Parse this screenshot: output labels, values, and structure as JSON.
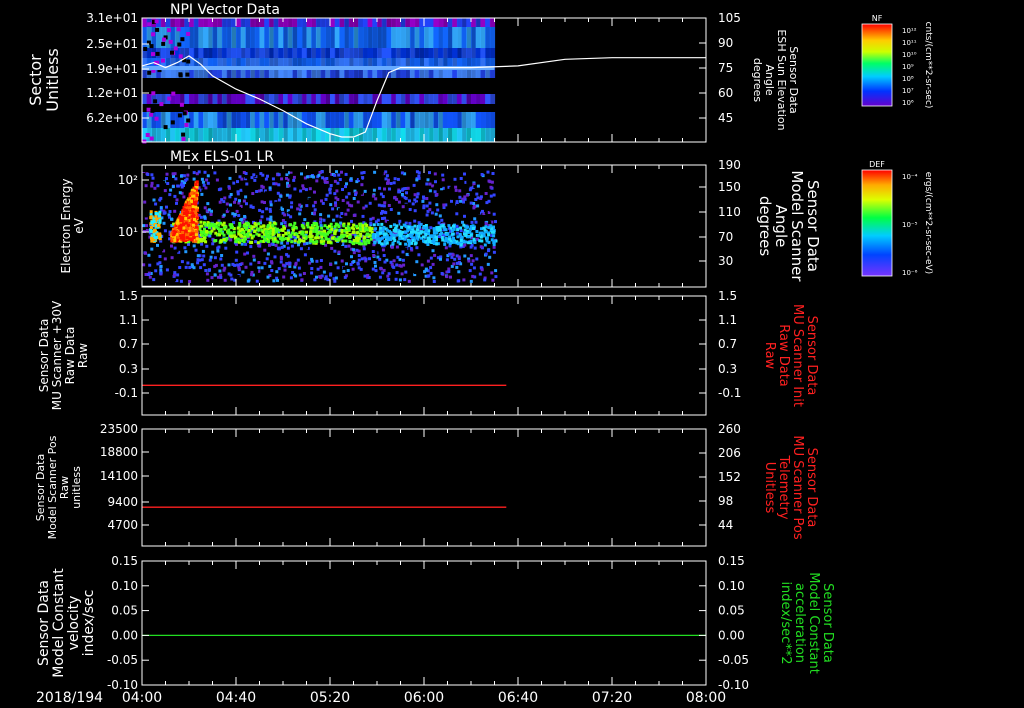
{
  "time_axis": {
    "date": "2018/194",
    "ticks": [
      "04:00",
      "04:40",
      "05:20",
      "06:00",
      "06:40",
      "07:20",
      "08:00"
    ],
    "range_minutes": [
      0,
      240
    ]
  },
  "colors": {
    "background": "#000000",
    "frame": "#ffffff",
    "red_series": "#ff2020",
    "green_series": "#22dd22"
  },
  "chart_data": [
    {
      "type": "heatmap",
      "title": "NPI Vector Data",
      "ylabel": [
        "Sector",
        "Unitless"
      ],
      "y_ticks": [
        "3.1e+01",
        "2.5e+01",
        "1.9e+01",
        "1.2e+01",
        "6.2e+00"
      ],
      "y2label": [
        "Sensor Data",
        "ESH Sun Elevation",
        "Angle",
        "degrees"
      ],
      "y2_ticks": [
        "105",
        "90",
        "75",
        "60",
        "45"
      ],
      "y2lim": [
        30,
        105
      ],
      "data_extent_minutes": [
        0,
        150
      ],
      "overlay_line": {
        "color": "#ffffff",
        "x": [
          0,
          5,
          10,
          15,
          20,
          25,
          30,
          40,
          50,
          60,
          70,
          80,
          85,
          90,
          95,
          100,
          105,
          110,
          120,
          140,
          160,
          180,
          200,
          220,
          240
        ],
        "y": [
          76,
          78,
          75,
          78,
          82,
          77,
          70,
          62,
          56,
          49,
          41,
          35,
          33,
          33,
          36,
          55,
          72,
          75,
          75,
          75,
          76,
          80,
          81,
          81,
          81
        ]
      },
      "colorbar": {
        "label": "NF",
        "unit": "cnts/(cm**2-sr-sec)",
        "ticks": [
          "10¹²",
          "10¹¹",
          "10¹⁰",
          "10⁹",
          "10⁸",
          "10⁷",
          "10⁶"
        ]
      }
    },
    {
      "type": "heatmap",
      "title": "MEx ELS-01 LR",
      "ylabel": [
        "Electron Energy",
        "eV"
      ],
      "y_ticks": [
        "10²",
        "10¹"
      ],
      "y2label": [
        "Sensor Data",
        "Model Scanner",
        "Angle",
        "degrees"
      ],
      "y2_ticks": [
        "190",
        "150",
        "110",
        "70",
        "30"
      ],
      "y2lim": [
        10,
        190
      ],
      "data_extent_minutes": [
        0,
        150
      ],
      "overlay_line": {
        "color": "#ffffff",
        "x": [
          0,
          150
        ],
        "y": [
          11,
          11
        ]
      },
      "colorbar": {
        "label": "DEF",
        "unit": "ergs/(cm**2-sr-sec-eV)",
        "ticks": [
          "10⁻⁴",
          "10⁻⁵",
          "10⁻⁶"
        ]
      }
    },
    {
      "type": "line",
      "ylabel": [
        "Sensor Data",
        "MU Scanner +30V",
        "Raw Data",
        "Raw"
      ],
      "y_ticks": [
        "1.5",
        "1.1",
        "0.7",
        "0.3",
        "-0.1"
      ],
      "ylim": [
        -0.5,
        1.5
      ],
      "y2label": [
        "Sensor Data",
        "MU Scanner Init",
        "Raw Data",
        "Raw"
      ],
      "y2_ticks": [
        "1.5",
        "1.1",
        "0.7",
        "0.3",
        "-0.1"
      ],
      "y2lim": [
        -0.5,
        1.5
      ],
      "series": [
        {
          "x": [
            0,
            155
          ],
          "y": [
            0.0,
            0.0
          ]
        }
      ]
    },
    {
      "type": "line",
      "ylabel": [
        "Sensor Data",
        "Model Scanner Pos",
        "Raw",
        "unitless"
      ],
      "y_ticks": [
        "23500",
        "18800",
        "14100",
        "9400",
        "4700"
      ],
      "ylim": [
        0,
        23500
      ],
      "y2label": [
        "Sensor Data",
        "MU Scanner Pos",
        "Telemetry",
        "Unitless"
      ],
      "y2_ticks": [
        "260",
        "206",
        "152",
        "98",
        "44"
      ],
      "y2lim": [
        -10,
        260
      ],
      "series": [
        {
          "x": [
            0,
            155
          ],
          "y": [
            7800,
            7800
          ]
        }
      ]
    },
    {
      "type": "line",
      "ylabel": [
        "Sensor Data",
        "Model Constant",
        "velocity",
        "index/sec"
      ],
      "y_ticks": [
        "0.15",
        "0.10",
        "0.05",
        "0.00",
        "-0.05",
        "-0.10"
      ],
      "ylim": [
        -0.1,
        0.15
      ],
      "y2label": [
        "Sensor Data",
        "Model Constant",
        "acceleration",
        "index/sec**2"
      ],
      "y2_ticks": [
        "0.15",
        "0.10",
        "0.05",
        "0.00",
        "-0.05",
        "-0.10"
      ],
      "y2lim": [
        -0.1,
        0.15
      ],
      "series": [
        {
          "x": [
            0,
            240
          ],
          "y": [
            0.0,
            0.0
          ]
        }
      ]
    }
  ]
}
